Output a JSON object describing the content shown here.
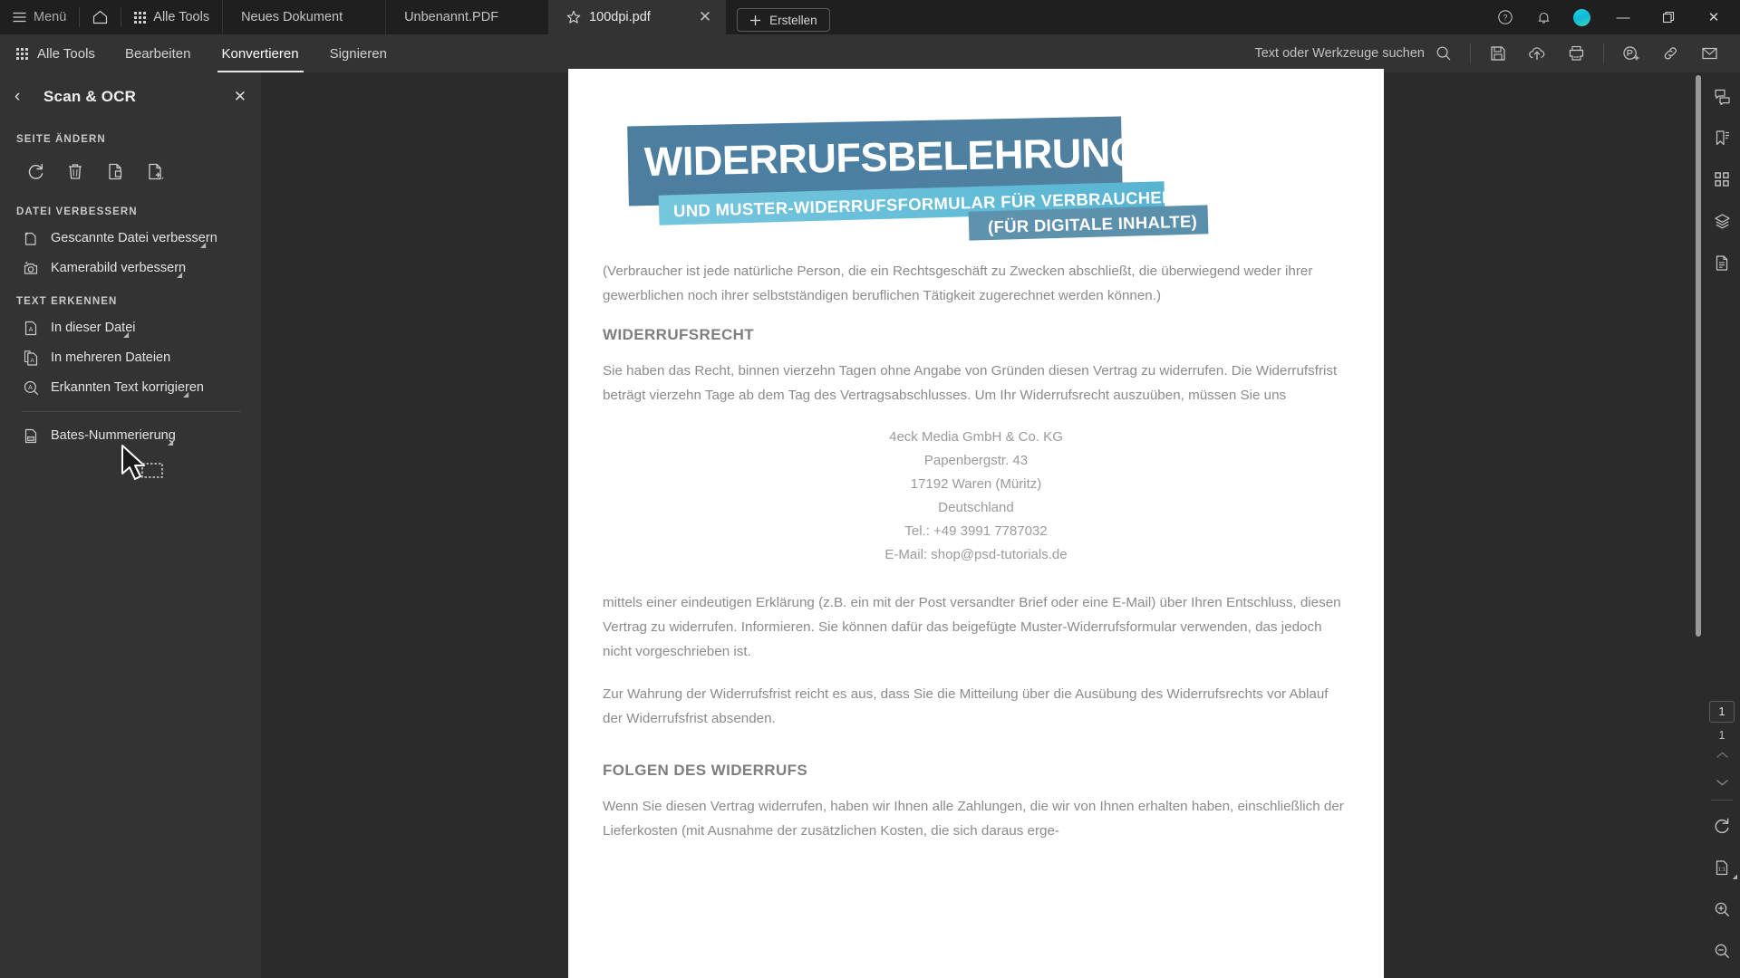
{
  "titlebar": {
    "menu_label": "Menü",
    "home_icon": "home-icon",
    "all_tools_label": "Alle Tools",
    "tabs": [
      {
        "label": "Neues Dokument",
        "active": false,
        "starred": false
      },
      {
        "label": "Unbenannt.PDF",
        "active": false,
        "starred": false
      },
      {
        "label": "100dpi.pdf",
        "active": true,
        "starred": true
      }
    ],
    "close_tab_glyph": "✕",
    "create_label": "Erstellen",
    "help_icon": "help-circle-icon",
    "bell_icon": "notification-bell-icon",
    "avatar_icon": "user-avatar",
    "minimize_glyph": "—",
    "restore_glyph": "❐",
    "close_glyph": "✕"
  },
  "menubar": {
    "all_tools_label": "Alle Tools",
    "items": [
      {
        "label": "Bearbeiten",
        "selected": false
      },
      {
        "label": "Konvertieren",
        "selected": true
      },
      {
        "label": "Signieren",
        "selected": false
      }
    ],
    "search_placeholder": "Text oder Werkzeuge suchen",
    "icons": [
      "search-icon",
      "save-icon",
      "cloud-upload-icon",
      "print-icon",
      "add-stamp-icon",
      "link-icon",
      "mail-icon"
    ]
  },
  "left_panel": {
    "title": "Scan & OCR",
    "back_glyph": "‹",
    "close_glyph": "✕",
    "sections": [
      {
        "heading": "SEITE ÄNDERN",
        "icon_buttons": [
          "rotate-page-icon",
          "delete-page-icon",
          "extract-page-icon",
          "insert-page-icon"
        ]
      },
      {
        "heading": "DATEI VERBESSERN",
        "items": [
          {
            "label": "Gescannte Datei verbessern",
            "icon": "enhance-scan-icon",
            "has_caret": true
          },
          {
            "label": "Kamerabild verbessern",
            "icon": "enhance-camera-icon",
            "has_caret": true
          }
        ]
      },
      {
        "heading": "TEXT ERKENNEN",
        "items": [
          {
            "label": "In dieser Datei",
            "icon": "ocr-file-icon",
            "has_caret": true
          },
          {
            "label": "In mehreren Dateien",
            "icon": "ocr-multifile-icon",
            "has_caret": false
          },
          {
            "label": "Erkannten Text korrigieren",
            "icon": "correct-text-icon",
            "has_caret": true
          },
          {
            "label": "Bates-Nummerierung",
            "icon": "bates-numbering-icon",
            "has_caret": true
          }
        ]
      }
    ]
  },
  "tool_strip": {
    "tools": [
      {
        "name": "select-tool",
        "active": true,
        "caret": true
      },
      {
        "name": "add-comment-tool",
        "active": false,
        "caret": true
      },
      {
        "name": "highlight-tool",
        "active": false,
        "caret": true
      },
      {
        "name": "draw-lasso-tool",
        "active": false,
        "caret": true
      },
      {
        "name": "select-text-region-tool",
        "active": false,
        "caret": true
      },
      {
        "name": "erase-tool",
        "active": false,
        "caret": true
      },
      {
        "name": "more-tools",
        "active": false,
        "caret": false
      }
    ],
    "more_glyph": "•••"
  },
  "document": {
    "title_band_main": "WIDERRUFSBELEHRUNG",
    "title_band_sub": "UND MUSTER-WIDERRUFSFORMULAR FÜR VERBRAUCHER",
    "title_band_sub2": "(FÜR DIGITALE INHALTE)",
    "intro": "(Verbraucher ist jede natürliche Person, die ein Rechtsgeschäft zu Zwecken abschließt, die überwiegend weder ihrer gewerblichen noch ihrer selbstständigen beruflichen Tätigkeit zugerechnet werden können.)",
    "heading_1": "WIDERRUFSRECHT",
    "para_1": "Sie haben das Recht, binnen vierzehn Tagen ohne Angabe von Gründen diesen Vertrag zu widerrufen. Die Widerrufsfrist beträgt vierzehn Tage ab dem Tag des Vertragsabschlusses. Um Ihr Widerrufsrecht auszuüben, müssen Sie uns",
    "address": [
      "4eck Media GmbH & Co. KG",
      "Papenbergstr. 43",
      "17192 Waren (Müritz)",
      "Deutschland",
      "Tel.: +49 3991 7787032",
      "E-Mail: shop@psd-tutorials.de"
    ],
    "para_2": "mittels einer eindeutigen Erklärung (z.B. ein mit der Post versandter Brief oder eine E-Mail) über Ihren Entschluss, diesen Vertrag zu widerrufen. Informieren. Sie können dafür das beigefügte Muster-Widerrufsformular verwenden, das jedoch nicht vorgeschrieben ist.",
    "para_3": "Zur Wahrung der Widerrufsfrist reicht es aus, dass Sie die Mitteilung über die Ausübung des Widerrufsrechts vor Ablauf der Widerrufsfrist absenden.",
    "heading_2": "FOLGEN DES WIDERRUFS",
    "para_4": "Wenn Sie diesen Vertrag widerrufen, haben wir Ihnen alle Zahlungen, die wir von Ihnen erhalten haben, einschließlich der Lieferkosten (mit Ausnahme der zusätzlichen Kosten, die sich daraus erge-"
  },
  "right_rail": {
    "top_icons": [
      "comments-icon",
      "bookmarks-icon",
      "page-thumbnails-icon",
      "layers-icon",
      "document-pages-icon"
    ],
    "current_page": "1",
    "total_pages": "1",
    "up_glyph": "⌃",
    "down_glyph": "⌄",
    "bottom_icons": [
      "rotate-view-icon",
      "fit-actual-size-icon",
      "zoom-in-icon",
      "zoom-out-icon"
    ]
  },
  "colors": {
    "accent_blue": "#1473e6",
    "titlebar_bg": "#1f1f1f",
    "menubar_bg": "#333333",
    "panel_bg": "#333333",
    "canvas_bg": "#2b2b2b",
    "band_main": "#4c7ea0",
    "band_sub": "#63bdd8"
  }
}
